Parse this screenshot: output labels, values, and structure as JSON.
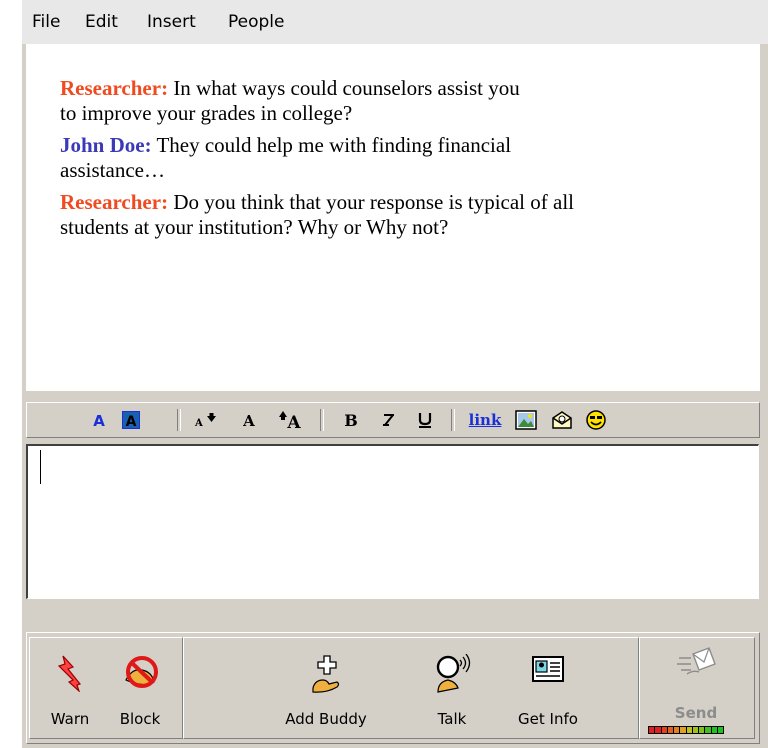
{
  "menubar": {
    "items": [
      {
        "label": "File"
      },
      {
        "label": "Edit"
      },
      {
        "label": "Insert"
      },
      {
        "label": "People"
      }
    ]
  },
  "chat_log": {
    "lines": [
      {
        "speaker": "Researcher:",
        "text": " In what ways could counselors assist you"
      },
      {
        "speaker": "",
        "text": "to improve your grades in college?"
      },
      {
        "speaker": "John Doe:",
        "text": " They could help me with finding financial"
      },
      {
        "speaker": "",
        "text": "assistance…"
      },
      {
        "speaker": "Researcher:",
        "text": " Do you think that your response is typical of all"
      },
      {
        "speaker": "",
        "text": "students at your institution? Why or Why not?"
      }
    ],
    "colors": {
      "researcher": "#f04a20",
      "john_doe": "#3a3ab8"
    }
  },
  "format_toolbar": {
    "link_label": "link",
    "buttons": [
      {
        "icon": "text-color-icon"
      },
      {
        "icon": "background-color-icon"
      },
      {
        "icon": "decrease-font-size-icon"
      },
      {
        "icon": "normal-font-size-icon"
      },
      {
        "icon": "increase-font-size-icon"
      },
      {
        "icon": "bold-icon"
      },
      {
        "icon": "italic-icon"
      },
      {
        "icon": "underline-icon"
      },
      {
        "icon": "insert-link-icon"
      },
      {
        "icon": "insert-image-icon"
      },
      {
        "icon": "insert-email-icon"
      },
      {
        "icon": "smiley-icon"
      }
    ]
  },
  "compose": {
    "value": ""
  },
  "action_buttons": {
    "warn": "Warn",
    "block": "Block",
    "add_buddy": "Add Buddy",
    "talk": "Talk",
    "get_info": "Get Info",
    "send": "Send"
  }
}
